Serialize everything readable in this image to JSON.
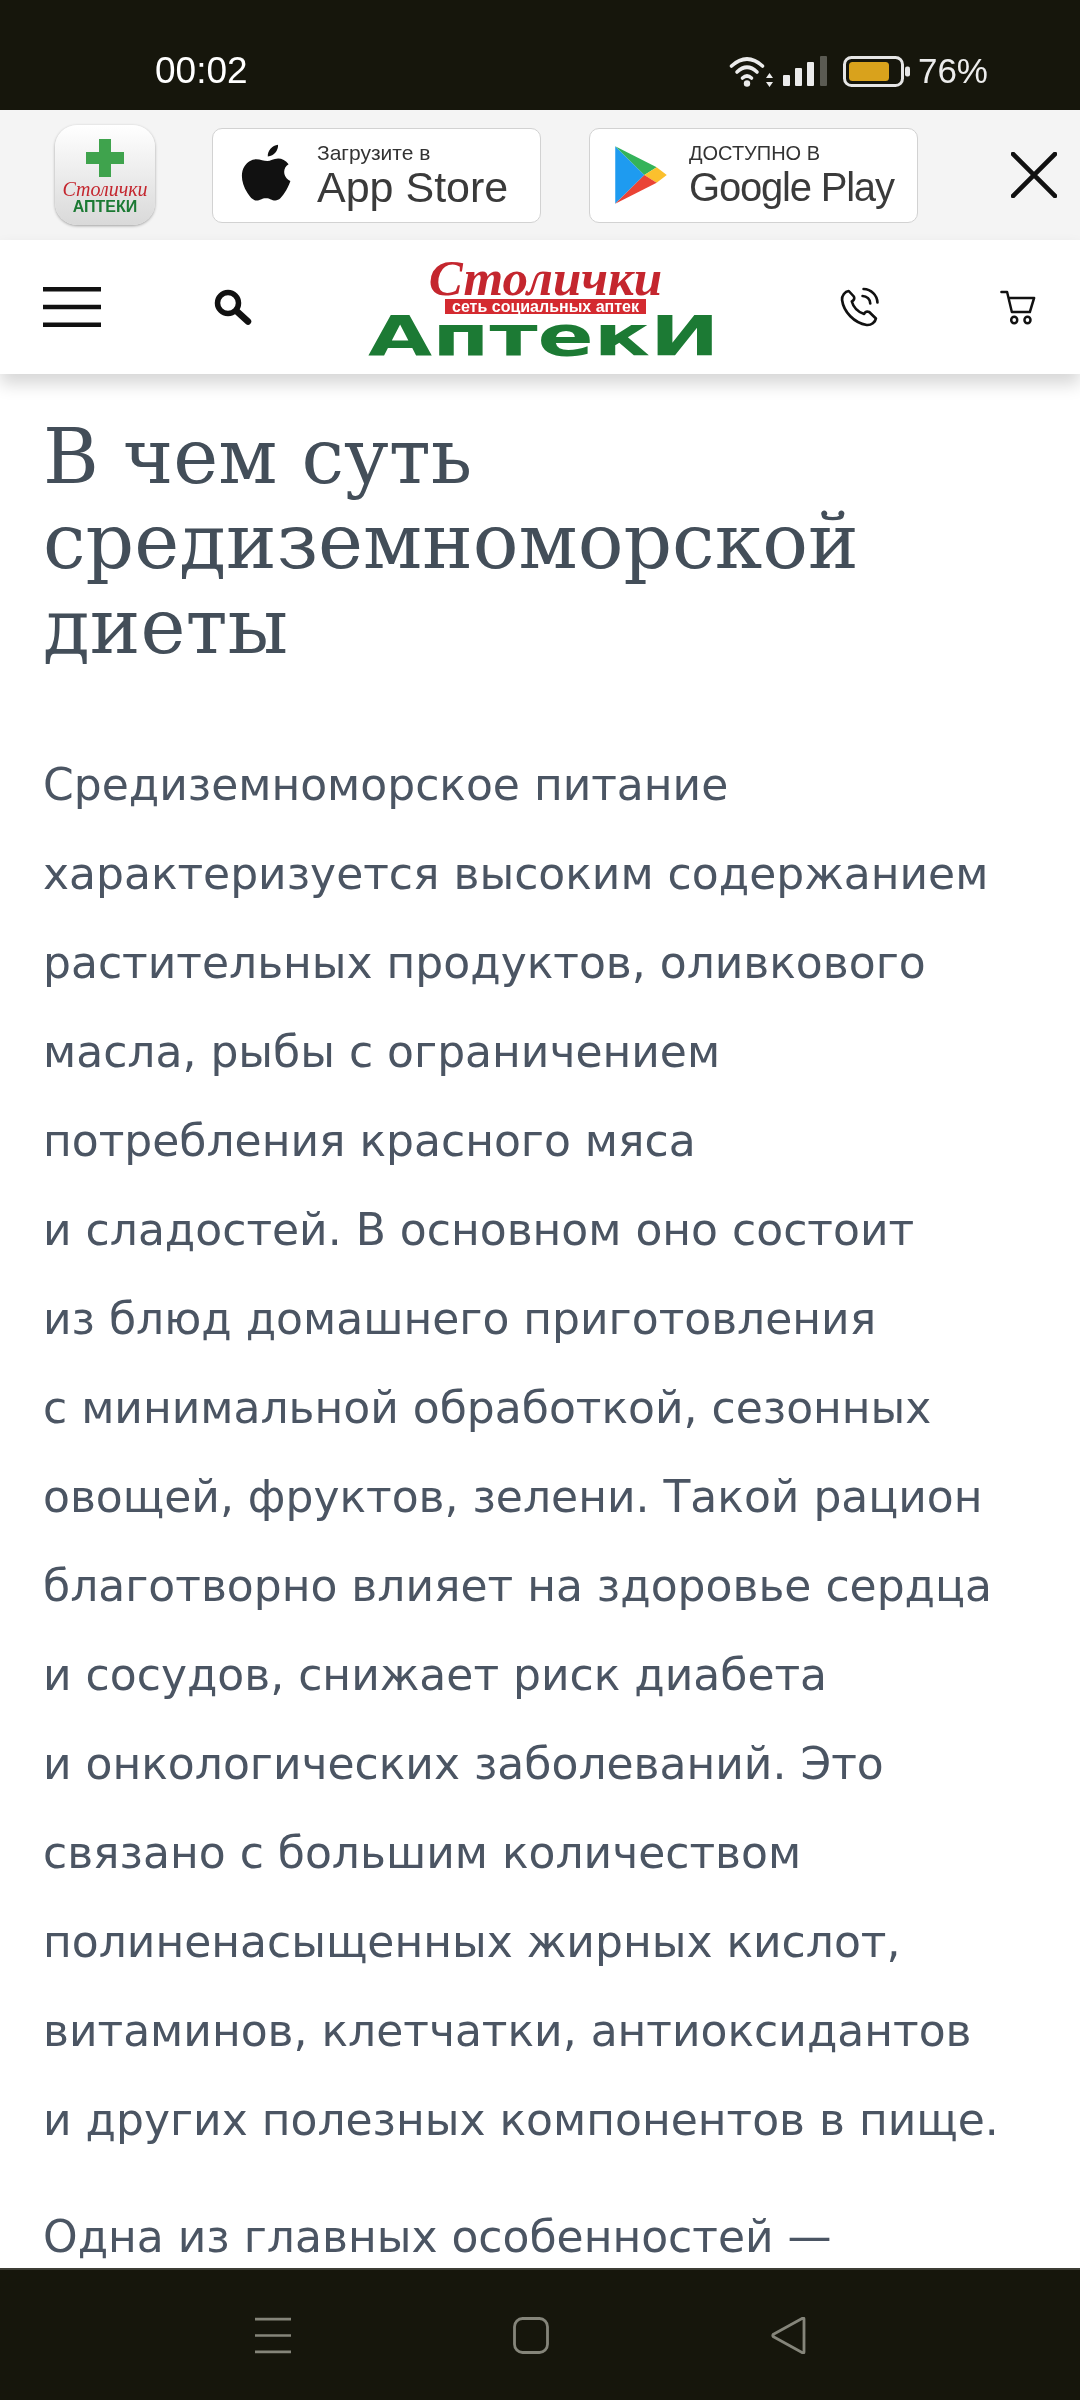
{
  "status_bar": {
    "time": "00:02",
    "battery": "76%"
  },
  "app_banner": {
    "app_logo": {
      "script": "Столички",
      "wordmark": "АПТЕКИ"
    },
    "store_buttons": [
      {
        "kind": "apple",
        "caption": "Загрузите в",
        "store": "App Store"
      },
      {
        "kind": "google",
        "caption": "ДОСТУПНО В",
        "store": "Google Play"
      }
    ]
  },
  "header": {
    "logo": {
      "script": "Столички",
      "tagline": "сеть социальных аптек",
      "wordmark": "АптекИ"
    }
  },
  "article": {
    "title": "В чем суть средиземноморской диеты",
    "paragraphs": [
      "Средиземноморское питание характеризуется высоким содержанием растительных продуктов, оливкового масла, рыбы с ограничением потребления красного мяса и сладостей. В основном оно состоит из блюд домашнего приготовления с минимальной обработкой, сезонных овощей, фруктов, зелени. Такой рацион благотворно влияет на здоровье сердца и сосудов, снижает риск диабета и онкологических заболеваний. Это связано с большим количеством полиненасыщенных жирных кислот, витаминов, клетчатки, антиоксидантов и других полезных компонентов в пище.",
      "Одна из главных особенностей —"
    ]
  }
}
